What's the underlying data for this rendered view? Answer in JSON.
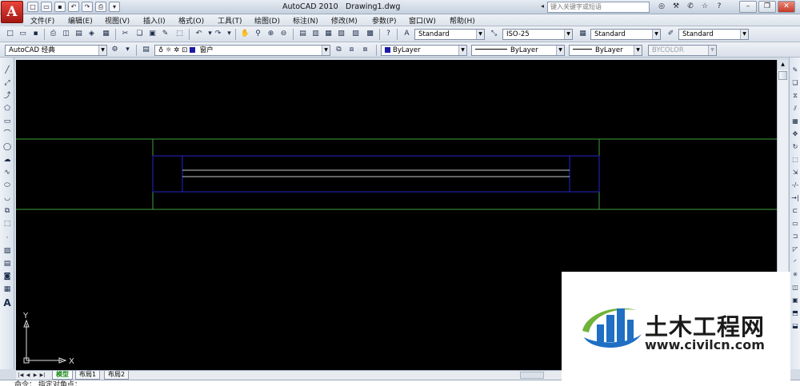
{
  "titlebar": {
    "logo_letter": "A",
    "app_name": "AutoCAD 2010",
    "document": "Drawing1.dwg",
    "search_placeholder": "键入关键字或短语"
  },
  "menu": [
    "文件(F)",
    "编辑(E)",
    "视图(V)",
    "插入(I)",
    "格式(O)",
    "工具(T)",
    "绘图(D)",
    "标注(N)",
    "修改(M)",
    "参数(P)",
    "窗口(W)",
    "帮助(H)"
  ],
  "styles": {
    "text_style": "Standard",
    "dim_style": "ISO-25",
    "table_style": "Standard",
    "multileader_style": "Standard"
  },
  "workspace": "AutoCAD 经典",
  "layer": {
    "name": "窗户",
    "color": "#1a1aa8"
  },
  "properties": {
    "color": "ByLayer",
    "linetype": "ByLayer",
    "lineweight": "ByLayer",
    "plotstyle": "BYCOLOR"
  },
  "ucs": {
    "x_label": "X",
    "y_label": "Y"
  },
  "layout_tabs": [
    "模型",
    "布局1",
    "布局2"
  ],
  "command_line": "命令： 指定对角点：",
  "watermark": {
    "name": "土木工程网",
    "url": "www.civilcn.com"
  },
  "colors": {
    "wall_line": "#3ea23e",
    "window_line": "#2626c8",
    "glass_line": "#c8c8c8",
    "canvas": "#000000"
  }
}
